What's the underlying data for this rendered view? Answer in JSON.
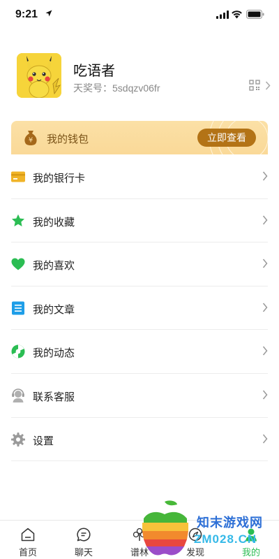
{
  "status_bar": {
    "time": "9:21"
  },
  "profile": {
    "username": "吃语者",
    "account_id": "天奖号：5sdqzv06fr",
    "avatar_icon": "pikachu-avatar"
  },
  "wallet": {
    "label": "我的钱包",
    "button_label": "立即查看",
    "icon": "money-bag-icon",
    "colors": {
      "banner": "#fad998",
      "button": "#b37316",
      "text": "#7a5318"
    }
  },
  "menu": {
    "items": [
      {
        "label": "我的银行卡",
        "icon": "bank-card-icon",
        "color": "#f0b428"
      },
      {
        "label": "我的收藏",
        "icon": "star-icon",
        "color": "#2bbd53"
      },
      {
        "label": "我的喜欢",
        "icon": "heart-icon",
        "color": "#2bbd53"
      },
      {
        "label": "我的文章",
        "icon": "article-icon",
        "color": "#1e9ee8"
      },
      {
        "label": "我的动态",
        "icon": "moments-icon",
        "color": "#2bbd53"
      },
      {
        "label": "联系客服",
        "icon": "customer-service-icon",
        "color": "#9a9a9a"
      },
      {
        "label": "设置",
        "icon": "gear-icon",
        "color": "#9a9a9a"
      }
    ]
  },
  "tab_bar": {
    "tabs": [
      {
        "label": "首页",
        "icon": "home-icon"
      },
      {
        "label": "聊天",
        "icon": "chat-icon"
      },
      {
        "label": "谱林",
        "icon": "tree-icon"
      },
      {
        "label": "发现",
        "icon": "compass-icon"
      },
      {
        "label": "我的",
        "icon": "person-icon",
        "active": true
      }
    ],
    "active_color": "#2bbd53"
  },
  "watermark": {
    "line1": "知末游戏网",
    "line2": "ZM028.CN"
  }
}
